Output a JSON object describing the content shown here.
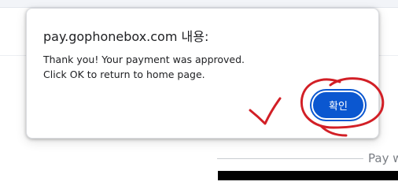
{
  "background": {
    "pay_label": "Pay w"
  },
  "dialog": {
    "title": "pay.gophonebox.com 내용:",
    "message_line1": "Thank you! Your payment was approved.",
    "message_line2": "Click OK to return to home page.",
    "ok_label": "확인"
  },
  "colors": {
    "accent": "#0b57d0",
    "annotation": "#d21f26"
  },
  "icons": [
    "checkmark-annotation",
    "circle-annotation"
  ]
}
